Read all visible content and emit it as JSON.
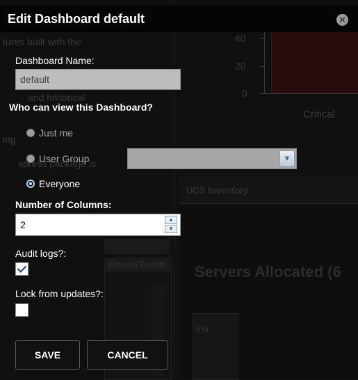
{
  "dialog": {
    "title": "Edit Dashboard default",
    "close_glyph": "✕",
    "dashboard_name_label": "Dashboard Name:",
    "dashboard_name_value": "default",
    "visibility_label": "Who can view this Dashboard?",
    "visibility_options": [
      {
        "label": "Just me",
        "selected": false
      },
      {
        "label": "User Group",
        "selected": false
      },
      {
        "label": "Everyone",
        "selected": true
      }
    ],
    "user_group_selected": "",
    "columns_label": "Number of Columns:",
    "columns_value": "2",
    "audit_logs_label": "Audit logs?:",
    "audit_logs_checked": true,
    "lock_label": "Lock from updates?:",
    "lock_checked": false,
    "save_label": "SAVE",
    "cancel_label": "CANCEL"
  },
  "background": {
    "frag_1": "tures built with the",
    "frag_2": "and historical",
    "frag_3": "ing",
    "frag_4": "xpress package is",
    "chart_ticks": [
      "40",
      "20",
      "0"
    ],
    "chart_category": "Critical",
    "panel_title": "UCS Inventory",
    "panel_heading": "Servers Allocated (6",
    "percent": "8%",
    "events_title": "Chassis Events"
  },
  "colors": {
    "title_bar": "#050505",
    "overlay_bg": "#101010",
    "chart_bar": "#2a0b0b",
    "text": "#ffffff"
  },
  "icons": {
    "close": "close-icon",
    "select_arrow": "chevron-down-icon",
    "spin_up": "chevron-up-icon",
    "spin_down": "chevron-down-icon",
    "check": "check-icon"
  }
}
